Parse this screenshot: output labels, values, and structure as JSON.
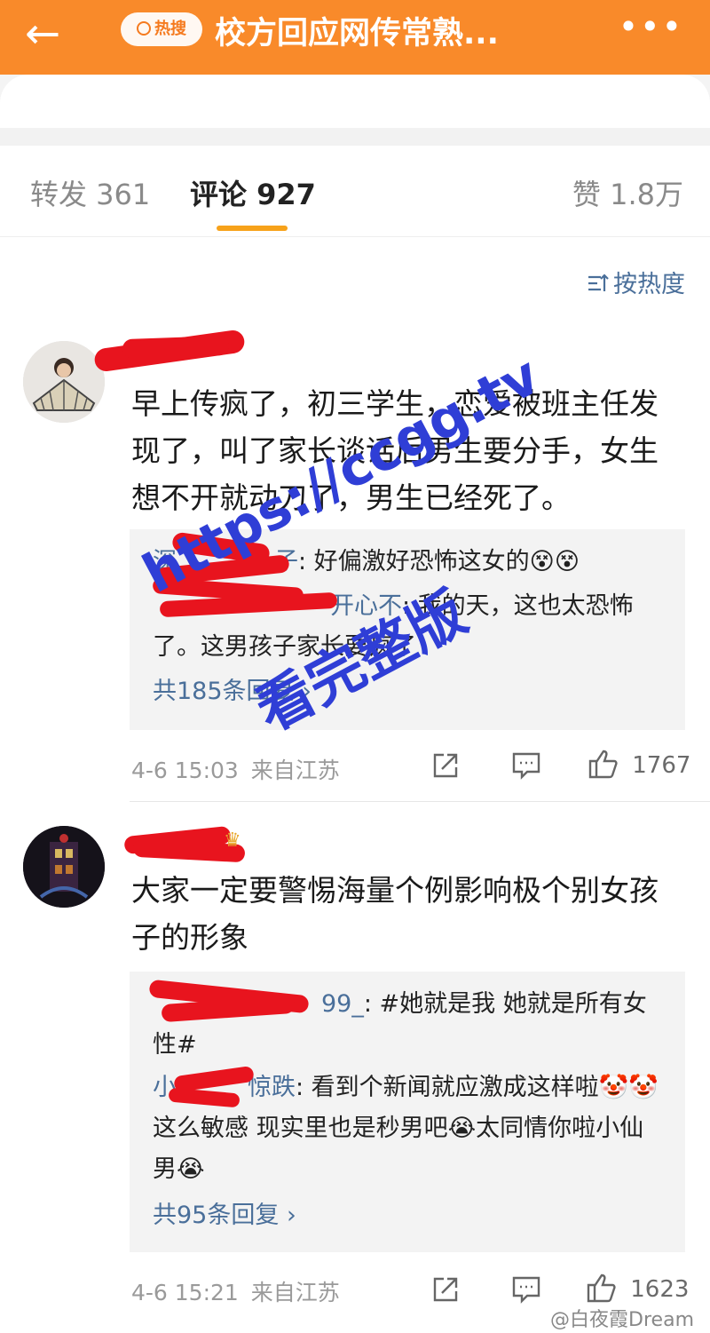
{
  "header": {
    "back_icon": "←",
    "badge": "热搜",
    "title": "校方回应网传常熟...",
    "more_icon": "•••"
  },
  "tabs": {
    "repost": "转发 361",
    "comments": "评论 927",
    "likes": "赞 1.8万"
  },
  "sort": {
    "label": "按热度"
  },
  "comments": [
    {
      "text": "早上传疯了，初三学生，恋爱被班主任发现了，叫了家长谈话后男生要分手，女生想不开就动刀了，男生已经死了。",
      "replies": [
        {
          "user": "深",
          "user_end": "子",
          "text": ": 好偏激好恐怖这女的😵😵"
        },
        {
          "user": "",
          "user_end": "开心不",
          "text": ": 我的天，这也太恐怖了。这男孩子家长要疯了"
        }
      ],
      "total": "共185条回复 ›",
      "time": "4-6 15:03",
      "source": "来自江苏",
      "likes": "1767"
    },
    {
      "text": "大家一定要警惕海量个例影响极个别女孩子的形象",
      "replies": [
        {
          "user": "",
          "user_end": "99_",
          "text": ": #她就是我 她就是所有女性#"
        },
        {
          "user": "小",
          "user_end": "惊跌",
          "text": ": 看到个新闻就应激成这样啦🤡🤡这么敏感 现实里也是秒男吧😭太同情你啦小仙男😭"
        }
      ],
      "total": "共95条回复 ›",
      "time": "4-6 15:21",
      "source": "来自江苏",
      "likes": "1623"
    }
  ],
  "watermark": {
    "url": "https://ccgg.tv",
    "text": "看完整版"
  },
  "credit": "@白夜霞Dream",
  "colors": {
    "accent": "#f98a2a",
    "link": "#4a6f9a",
    "redact": "#e8141e"
  }
}
